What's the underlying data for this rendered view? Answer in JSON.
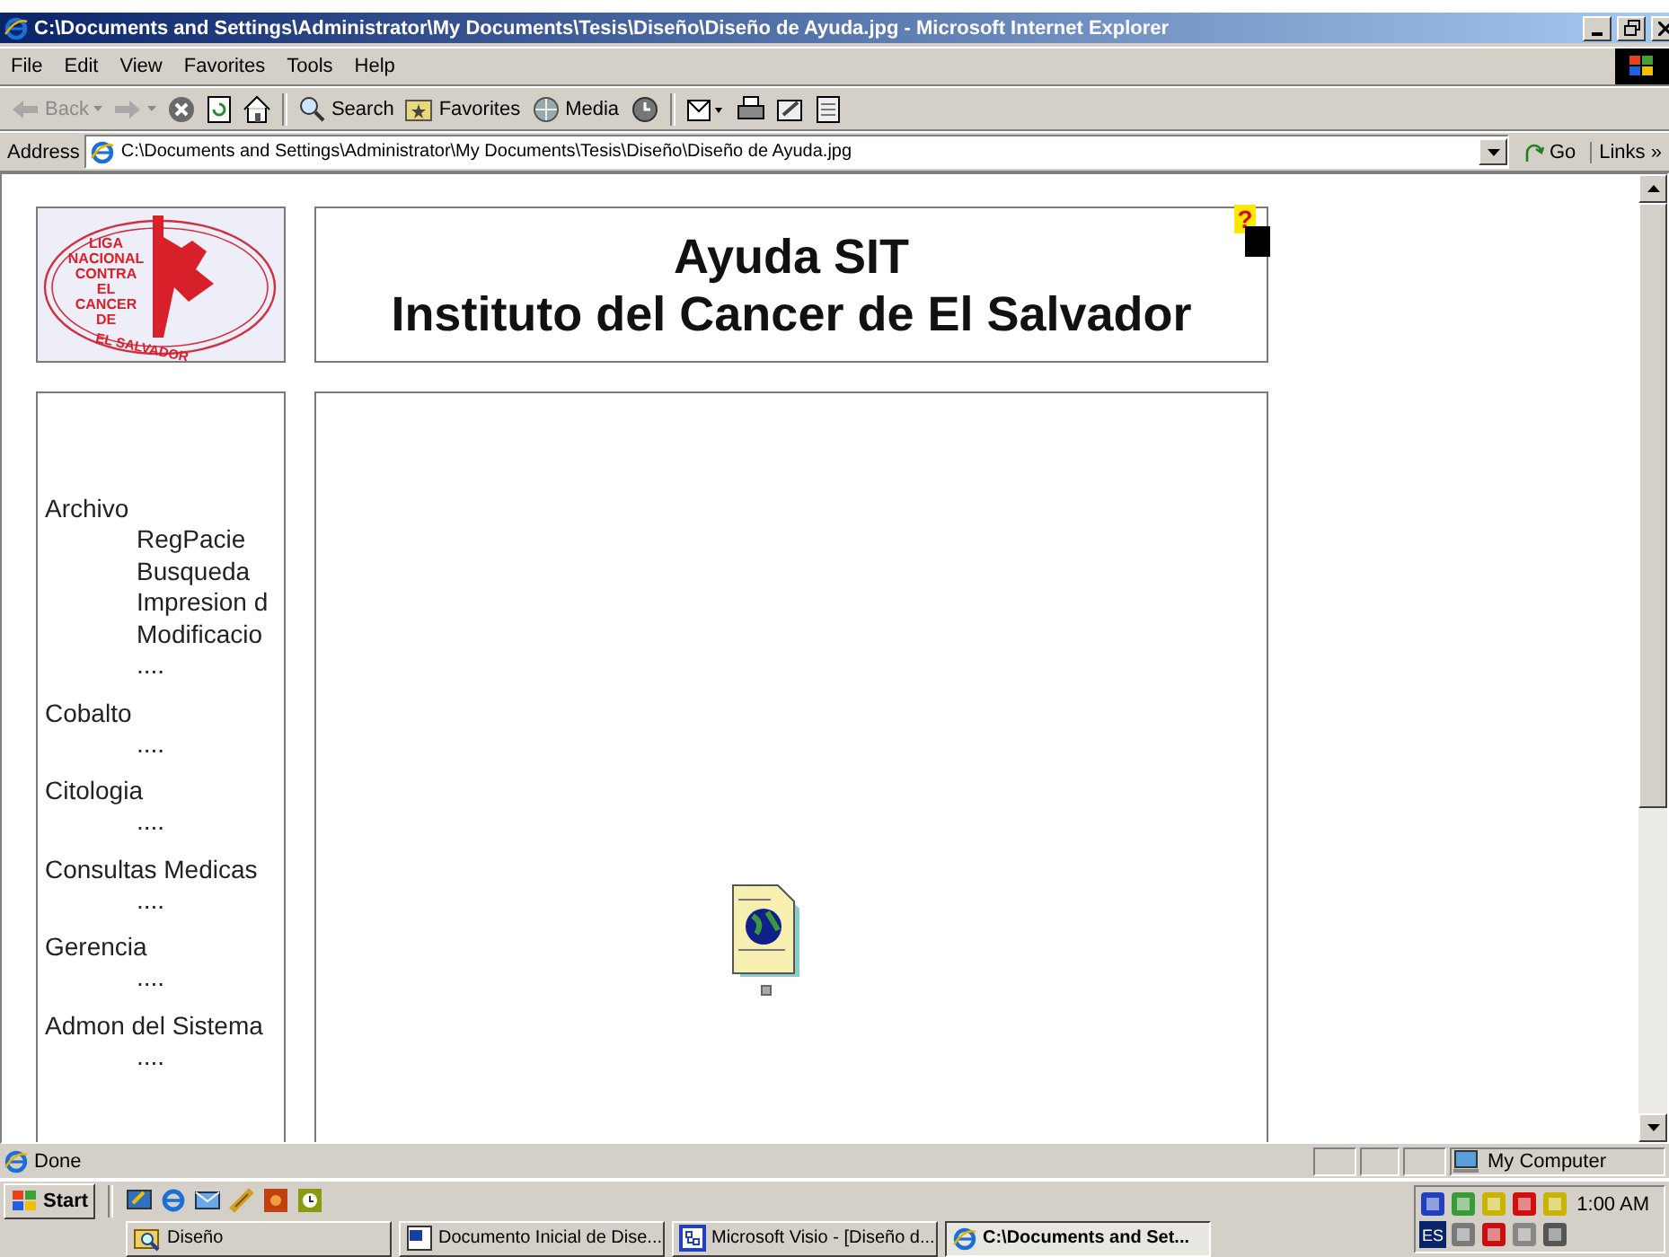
{
  "window": {
    "title": "C:\\Documents and Settings\\Administrator\\My Documents\\Tesis\\Diseño\\Diseño de Ayuda.jpg - Microsoft Internet Explorer"
  },
  "menu": [
    "File",
    "Edit",
    "View",
    "Favorites",
    "Tools",
    "Help"
  ],
  "toolbar": [
    {
      "kind": "back",
      "label": "Back",
      "disabled": true
    },
    {
      "kind": "forward",
      "disabled": true
    },
    {
      "kind": "stop"
    },
    {
      "kind": "refresh"
    },
    {
      "kind": "home"
    },
    {
      "kind": "search",
      "label": "Search"
    },
    {
      "kind": "favorites",
      "label": "Favorites"
    },
    {
      "kind": "media",
      "label": "Media"
    },
    {
      "kind": "history"
    },
    {
      "kind": "mail"
    },
    {
      "kind": "print"
    },
    {
      "kind": "edit"
    },
    {
      "kind": "discuss"
    }
  ],
  "address": {
    "label": "Address",
    "value": "C:\\Documents and Settings\\Administrator\\My Documents\\Tesis\\Diseño\\Diseño de Ayuda.jpg",
    "go": "Go",
    "links": "Links",
    "more": "»"
  },
  "page": {
    "logo": {
      "lines": [
        "LIGA",
        "NACIONAL",
        "CONTRA",
        "EL",
        "CANCER",
        "DE"
      ],
      "arc_text": "EL SALVADOR"
    },
    "header": [
      "Ayuda SIT",
      "Instituto del Cancer de El Salvador"
    ],
    "help": "?",
    "sidebar": [
      {
        "label": "Archivo",
        "children": [
          {
            "label": "RegPacie"
          },
          {
            "label": "Busqueda"
          },
          {
            "label": "Impresion d"
          },
          {
            "label": "Modificacio"
          },
          {
            "label": "...."
          }
        ]
      },
      {
        "label": "Cobalto",
        "children": [
          {
            "label": "...."
          }
        ]
      },
      {
        "label": "Citologia",
        "children": [
          {
            "label": "...."
          }
        ]
      },
      {
        "label": "Consultas Medicas",
        "children": [
          {
            "label": "...."
          }
        ]
      },
      {
        "label": "Gerencia",
        "children": [
          {
            "label": "...."
          }
        ]
      },
      {
        "label": "Admon del Sistema",
        "children": [
          {
            "label": "...."
          }
        ]
      }
    ]
  },
  "status_bar": {
    "text": "Done",
    "zone": "My Computer"
  },
  "taskbar": {
    "start": "Start",
    "quick_launch": [
      {
        "kind": "desktop"
      },
      {
        "kind": "browser"
      },
      {
        "kind": "mail"
      },
      {
        "kind": "media"
      },
      {
        "kind": "app"
      },
      {
        "kind": "clock"
      }
    ],
    "tasks": [
      {
        "label": "Diseño",
        "kind": "folder",
        "selected": false
      },
      {
        "label": "Documento Inicial de Dise...",
        "kind": "word",
        "selected": false
      },
      {
        "label": "Microsoft Visio - [Diseño d...",
        "kind": "visio",
        "selected": false
      },
      {
        "label": "C:\\Documents and Set...",
        "kind": "ie",
        "selected": true
      }
    ],
    "tray_language": "ES",
    "clock": "1:00 AM"
  }
}
